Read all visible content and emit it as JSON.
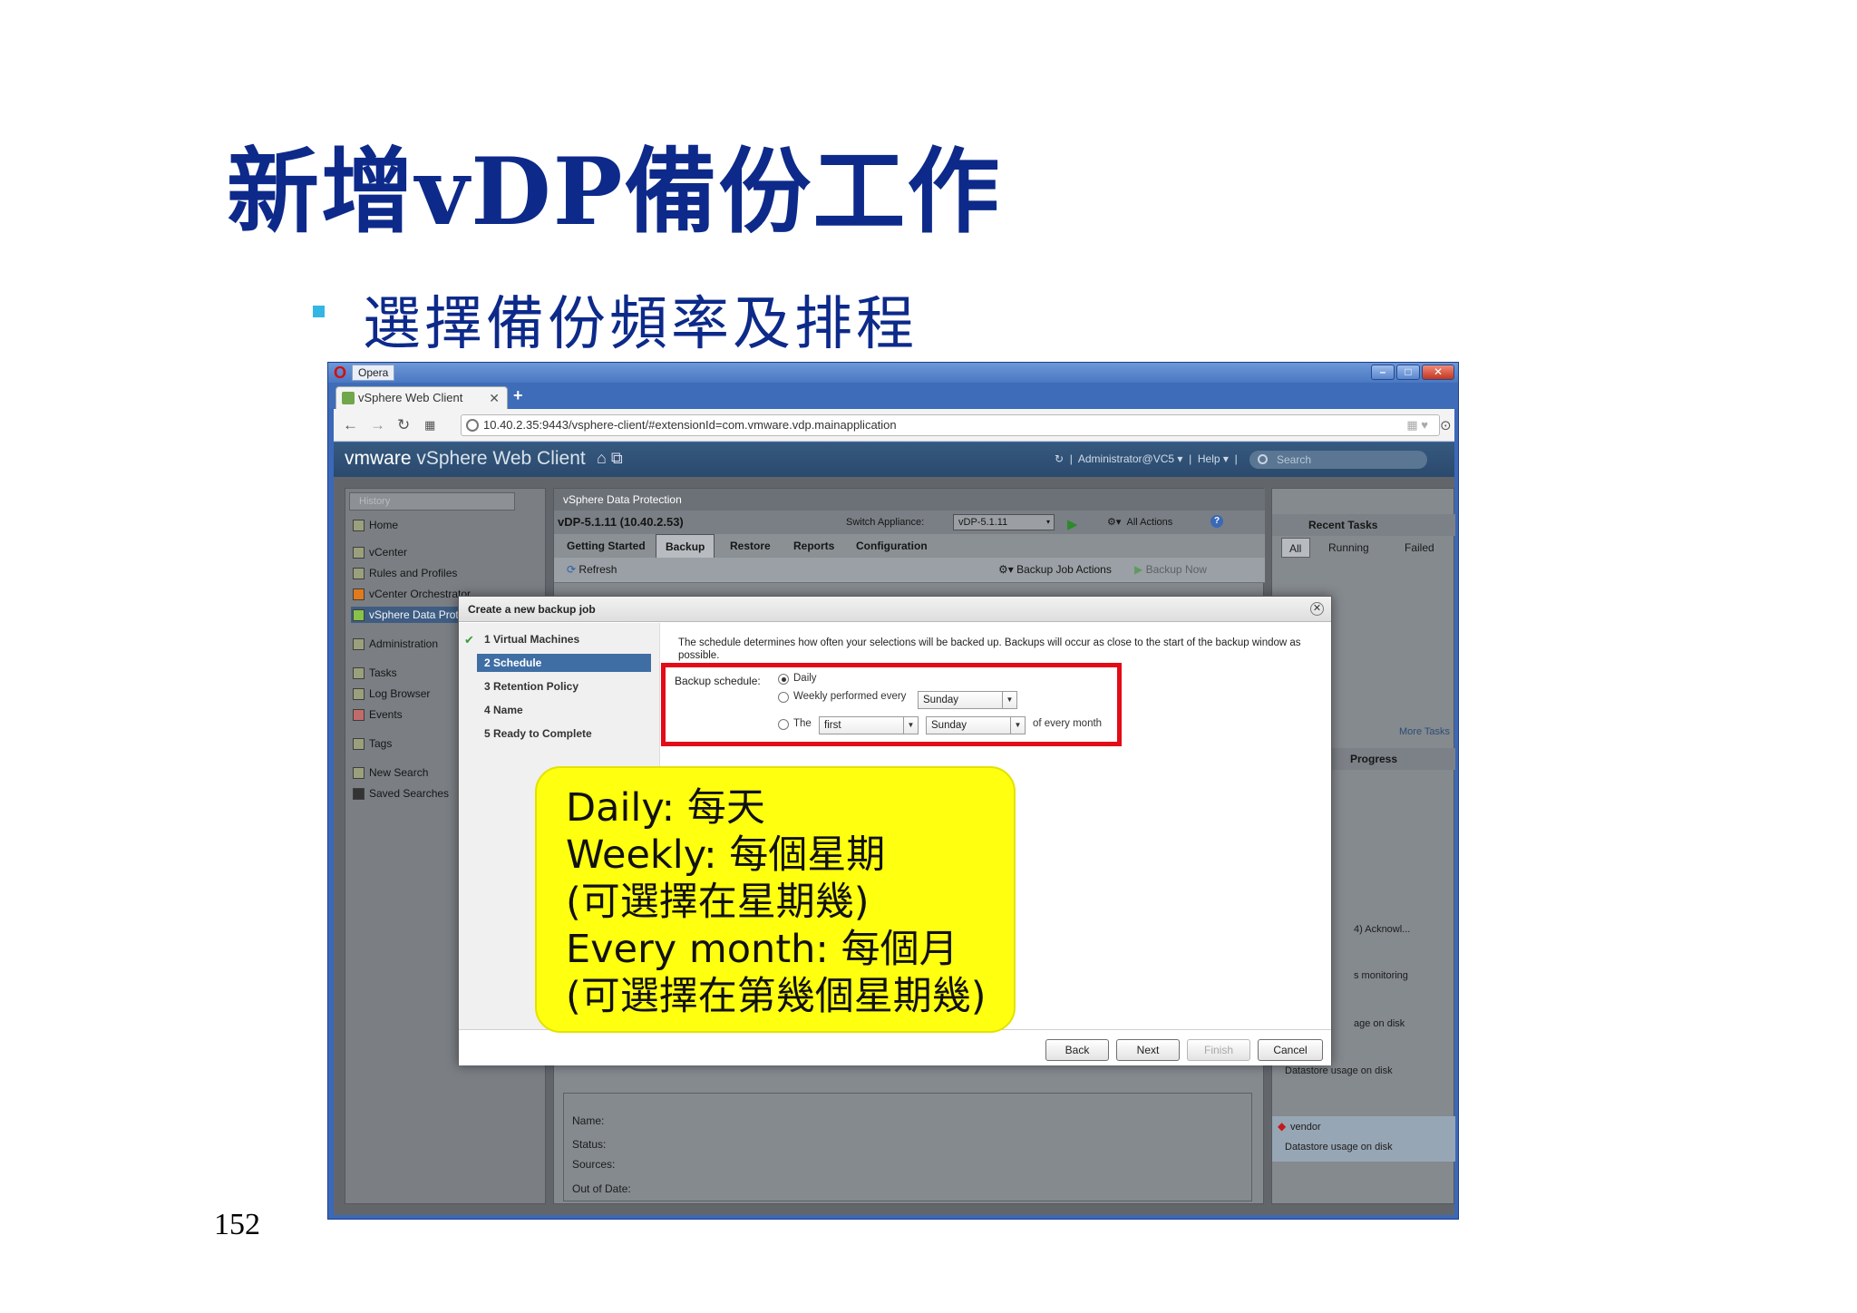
{
  "slide": {
    "title": "新增vDP備份工作",
    "subtitle": "選擇備份頻率及排程",
    "page_number": "152",
    "bullet_color": "#34b6e4",
    "title_color": "#0d2a8a"
  },
  "browser": {
    "app_name": "Opera",
    "tab_title": "vSphere Web Client",
    "url": "10.40.2.35:9443/vsphere-client/#extensionId=com.vmware.vdp.mainapplication"
  },
  "vsphere": {
    "logo_vm": "vmware",
    "logo_product": " vSphere Web Client",
    "user": "Administrator@VC5 ▾",
    "help": "Help ▾",
    "search_placeholder": "Search",
    "nav": {
      "history": "History",
      "items": [
        "Home",
        "vCenter",
        "Rules and Profiles",
        "vCenter Orchestrator",
        "vSphere Data Protection",
        "Administration",
        "Tasks",
        "Log Browser",
        "Events",
        "Tags",
        "New Search",
        "Saved Searches"
      ]
    },
    "center": {
      "panel_title": "vSphere Data Protection",
      "appliance_name": "vDP-5.1.11 (10.40.2.53)",
      "switch_label": "Switch Appliance:",
      "switch_value": "vDP-5.1.11",
      "all_actions": "All Actions",
      "tabs": [
        "Getting Started",
        "Backup",
        "Restore",
        "Reports",
        "Configuration"
      ],
      "active_tab": "Backup",
      "refresh": "Refresh",
      "backup_job_actions": "Backup Job Actions",
      "backup_now": "Backup Now",
      "detail_labels": [
        "Name:",
        "Status:",
        "Sources:",
        "Out of Date:"
      ]
    },
    "right": {
      "recent_tasks": "Recent Tasks",
      "filters": [
        "All",
        "Running",
        "Failed"
      ],
      "more_tasks": "More Tasks",
      "progress": "Progress",
      "acknowl": "4)     Acknowl...",
      "monitoring": "s monitoring",
      "usage_disk_partial": "age on disk",
      "datastore_usage_1": "Datastore usage on disk",
      "vendor": "vendor",
      "datastore_usage_2": "Datastore usage on disk"
    }
  },
  "modal": {
    "title": "Create a new backup job",
    "steps": [
      {
        "label": "1  Virtual Machines",
        "done": true
      },
      {
        "label": "2  Schedule",
        "selected": true
      },
      {
        "label": "3  Retention Policy"
      },
      {
        "label": "4  Name"
      },
      {
        "label": "5  Ready to Complete"
      }
    ],
    "description": "The schedule determines how often your selections will be backed up.  Backups will occur as close to the start of the backup window as possible.",
    "schedule_label": "Backup schedule:",
    "opt_daily": "Daily",
    "opt_weekly": "Weekly performed every",
    "weekly_day": "Sunday",
    "opt_the": "The",
    "monthly_ordinal": "first",
    "monthly_day": "Sunday",
    "of_every_month": "of every month",
    "selected_option": "Daily",
    "buttons": {
      "back": "Back",
      "next": "Next",
      "finish": "Finish",
      "cancel": "Cancel"
    }
  },
  "callout": {
    "lines": [
      "Daily: 每天",
      "Weekly: 每個星期",
      "(可選擇在星期幾)",
      "Every month: 每個月",
      "(可選擇在第幾個星期幾)"
    ],
    "bg_color": "#ffff10"
  }
}
